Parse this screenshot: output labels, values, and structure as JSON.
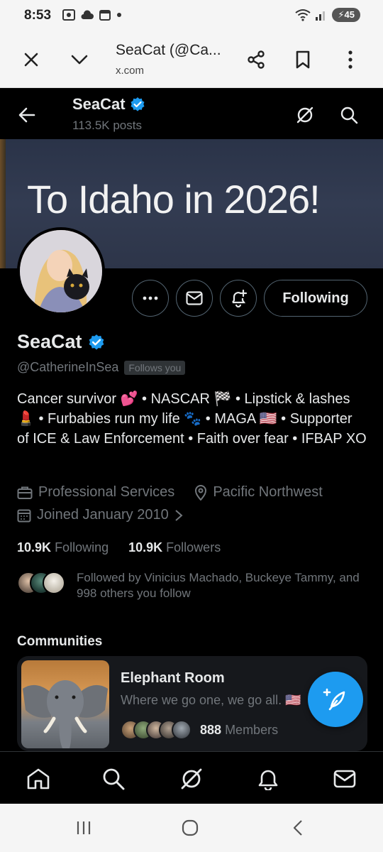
{
  "status_bar": {
    "time": "8:53",
    "battery": "45"
  },
  "browser_tab": {
    "title": "SeaCat (@Ca...",
    "url": "x.com"
  },
  "profile_header": {
    "name": "SeaCat",
    "posts": "113.5K posts"
  },
  "banner": {
    "text": "To Idaho in 2026!"
  },
  "actions": {
    "following_label": "Following"
  },
  "profile": {
    "name": "SeaCat",
    "handle": "@CatherineInSea",
    "follows_you": "Follows you",
    "bio": "Cancer survivor 💕 • NASCAR 🏁 • Lipstick & lashes 💄 • Furbabies run my life 🐾 • MAGA 🇺🇸 • Supporter of ICE & Law Enforcement  • Faith over fear • IFBAP XO",
    "category": "Professional Services",
    "location": "Pacific Northwest",
    "joined": "Joined January 2010",
    "following_count": "10.9K",
    "following_label": "Following",
    "followers_count": "10.9K",
    "followers_label": "Followers",
    "followed_by": "Followed by Vinicius Machado, Buckeye Tammy, and 998 others you follow"
  },
  "communities": {
    "title": "Communities",
    "items": [
      {
        "name": "Elephant Room",
        "description": "Where we go one, we go all. 🇺🇸",
        "member_count": "888",
        "member_label": "Members"
      }
    ]
  },
  "colors": {
    "accent": "#1d9bf0",
    "background": "#000000",
    "text_secondary": "#71767b",
    "border": "#2f3336"
  }
}
